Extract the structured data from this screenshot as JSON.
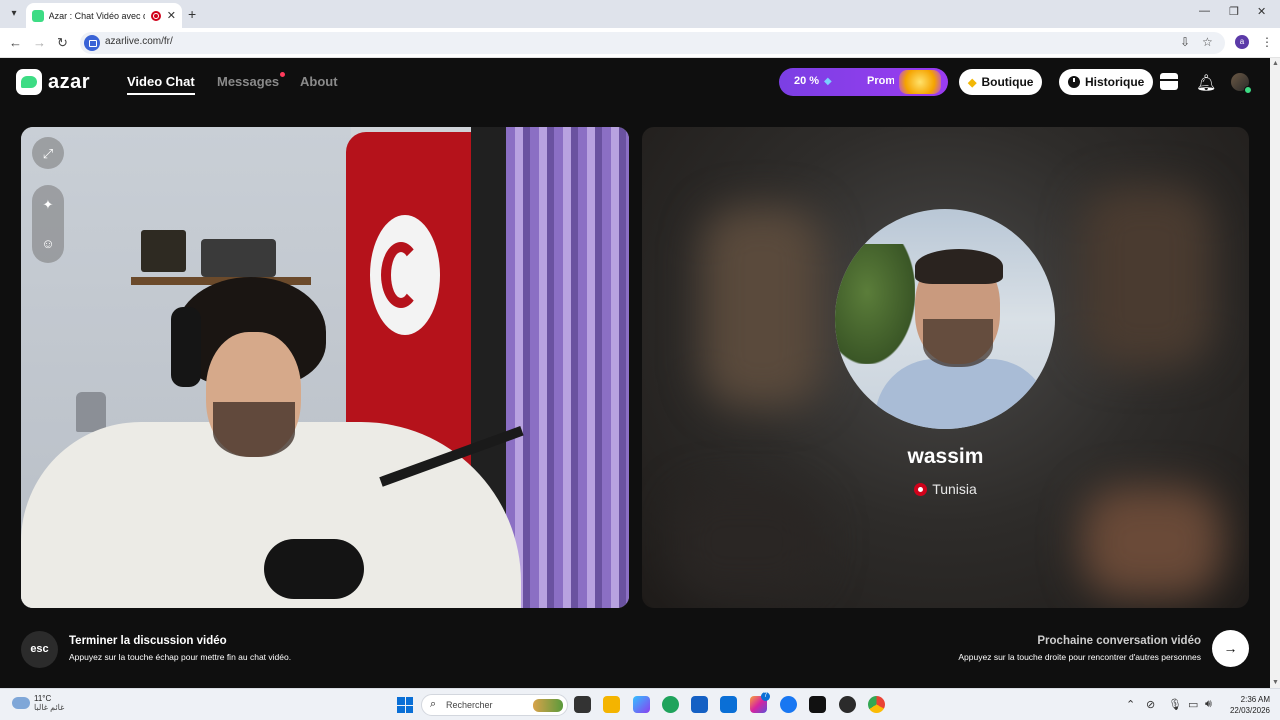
{
  "browser": {
    "tab_title": "Azar : Chat Vidéo avec de n",
    "url": "azarlive.com/fr/",
    "profile_initial": "a"
  },
  "header": {
    "logo_text": "azar",
    "nav": [
      {
        "label": "Video Chat",
        "active": true
      },
      {
        "label": "Messages",
        "active": false,
        "has_notification": true
      },
      {
        "label": "About",
        "active": false
      }
    ],
    "promo": {
      "percent": "20 %",
      "label": "Prom"
    },
    "boutique_label": "Boutique",
    "historique_label": "Historique"
  },
  "peer": {
    "name": "wassim",
    "country": "Tunisia"
  },
  "footer": {
    "esc_label": "esc",
    "end_title": "Terminer la discussion vidéo",
    "end_subtitle": "Appuyez sur la touche échap pour mettre fin au chat vidéo.",
    "next_title": "Prochaine conversation vidéo",
    "next_subtitle": "Appuyez sur la touche droite pour rencontrer d'autres personnes"
  },
  "taskbar": {
    "temperature": "11°C",
    "weather_condition": "غائم غالبا",
    "search_placeholder": "Rechercher",
    "instagram_badge": "7",
    "time": "2:36 AM",
    "date": "22/03/2026"
  },
  "colors": {
    "brand_green": "#3ddc84",
    "promo_purple": "#8a3ff0",
    "background": "#0f0f0f"
  }
}
